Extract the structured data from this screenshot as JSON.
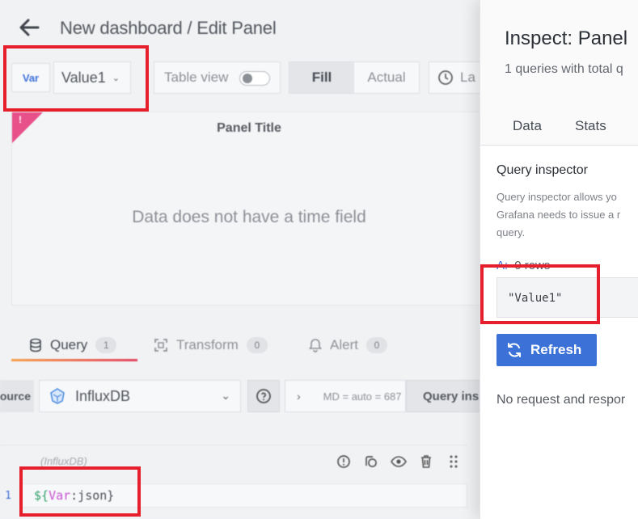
{
  "header": {
    "title": "New dashboard / Edit Panel"
  },
  "toolbar": {
    "var_label": "Var",
    "var_value": "Value1",
    "table_view_label": "Table view",
    "fill_label": "Fill",
    "actual_label": "Actual",
    "time_label": "La"
  },
  "panel": {
    "title": "Panel Title",
    "message": "Data does not have a time field",
    "alert_mark": "!"
  },
  "editor_tabs": [
    {
      "label": "Query",
      "count": "1"
    },
    {
      "label": "Transform",
      "count": "0"
    },
    {
      "label": "Alert",
      "count": "0"
    }
  ],
  "datasource": {
    "label": "ource",
    "name": "InfluxDB",
    "options": "MD = auto = 687",
    "inspector_label": "Query ins"
  },
  "query": {
    "ds_name": "(InfluxDB)",
    "line_number": "1",
    "code_prefix": "${",
    "code_var": "Var",
    "code_suffix": ":json}"
  },
  "drawer": {
    "title": "Inspect: Panel",
    "subtitle": "1 queries with total q",
    "tabs": [
      "Data",
      "Stats"
    ],
    "query_inspector_title": "Query inspector",
    "query_inspector_desc": [
      "Query inspector allows yo",
      "Grafana needs to issue a r",
      "query."
    ],
    "rows_letter": "A:",
    "rows_text": "0 rows",
    "result_value": "\"Value1\"",
    "refresh_label": "Refresh",
    "no_request_text": "No request and respor"
  },
  "colors": {
    "accent_blue": "#3c72d8",
    "annotation_red": "#e5202c",
    "alert_pink": "#e8508a"
  }
}
